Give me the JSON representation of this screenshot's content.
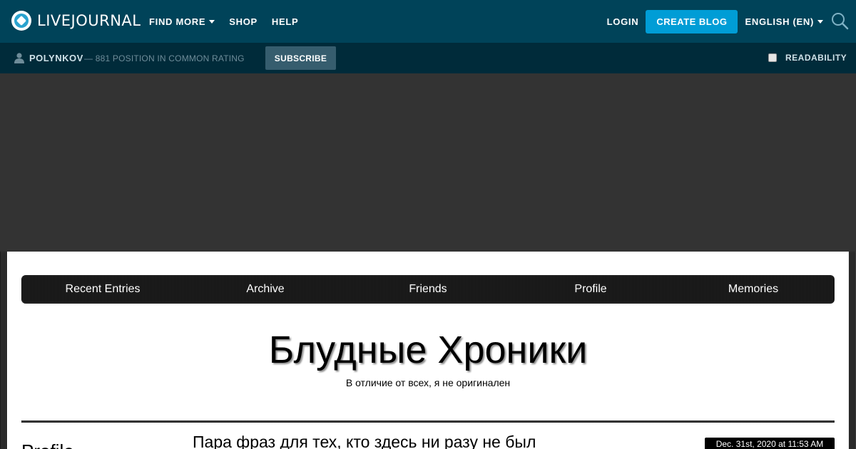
{
  "header": {
    "logo_text": "LIVEJOURNAL",
    "nav": [
      "FIND MORE",
      "SHOP",
      "HELP"
    ],
    "login": "LOGIN",
    "create_blog": "CREATE BLOG",
    "language": "ENGLISH (EN)",
    "search_icon": "search-icon"
  },
  "subbar": {
    "username": "POLYNKOV",
    "rating": "— 881 POSITION IN COMMON RATING",
    "subscribe": "SUBSCRIBE",
    "readability": "READABILITY"
  },
  "menu": [
    "Recent Entries",
    "Archive",
    "Friends",
    "Profile",
    "Memories"
  ],
  "blog": {
    "title": "Блудные Хроники",
    "subtitle": "В отличие от всех, я не оригинален"
  },
  "sidebar": {
    "heading": "Profile"
  },
  "entry": {
    "title": "Пара фраз для тех, кто здесь ни разу не был",
    "date": "Dec. 31st, 2020 at 11:53 AM"
  },
  "colors": {
    "topbar": "#004359",
    "subbar": "#002b3a",
    "accent": "#009dd6"
  }
}
